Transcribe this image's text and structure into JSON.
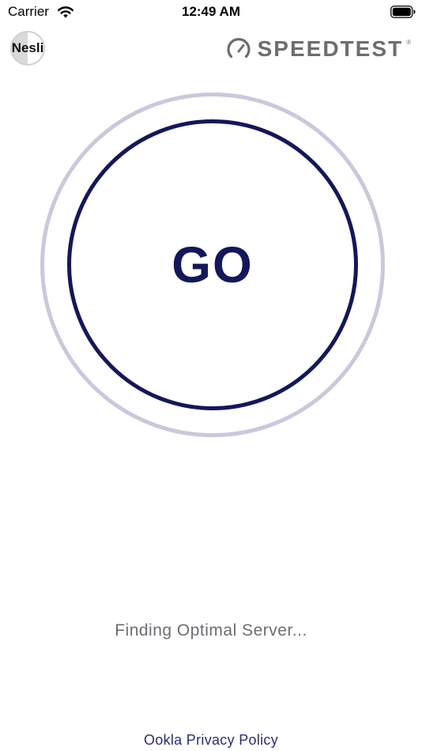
{
  "status_bar": {
    "carrier": "Carrier",
    "time": "12:49 AM",
    "wifi_icon": "wifi-icon",
    "battery_icon": "battery-icon"
  },
  "header": {
    "avatar_label": "Nesli",
    "logo_text": "SPEEDTEST",
    "logo_icon": "gauge-icon"
  },
  "main": {
    "go_label": "GO",
    "status": "Finding Optimal Server..."
  },
  "footer": {
    "privacy_link": "Ookla Privacy Policy"
  },
  "colors": {
    "accent": "#141759",
    "ring": "#c8c9dc",
    "logo_gray": "#6b6d72",
    "link": "#2a2f6f"
  }
}
